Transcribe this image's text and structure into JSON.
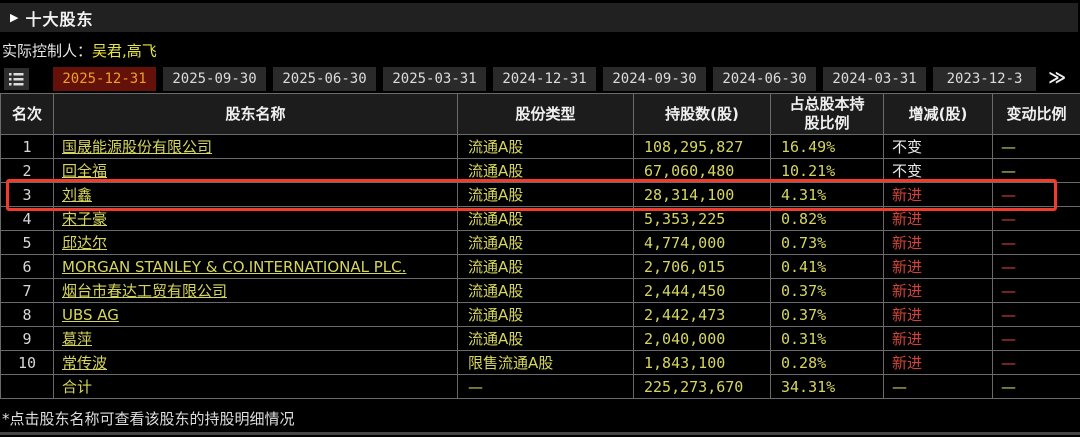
{
  "section": {
    "arrow": "▶",
    "title": "十大股东"
  },
  "controller": {
    "label": "实际控制人：",
    "value": "吴君,高飞"
  },
  "tabs": {
    "more_label": "≫",
    "dates": [
      {
        "label": "2025-12-31",
        "active": true
      },
      {
        "label": "2025-09-30",
        "active": false
      },
      {
        "label": "2025-06-30",
        "active": false
      },
      {
        "label": "2025-03-31",
        "active": false
      },
      {
        "label": "2024-12-31",
        "active": false
      },
      {
        "label": "2024-09-30",
        "active": false
      },
      {
        "label": "2024-06-30",
        "active": false
      },
      {
        "label": "2024-03-31",
        "active": false
      },
      {
        "label": "2023-12-3",
        "active": false
      }
    ]
  },
  "table": {
    "headers": [
      "名次",
      "股东名称",
      "股份类型",
      "持股数(股)",
      "占总股本持\n股比例",
      "增减(股)",
      "变动比例"
    ],
    "rows": [
      {
        "rank": "1",
        "name": "国晟能源股份有限公司",
        "share_type": "流通A股",
        "shares": "108,295,827",
        "pct": "16.49%",
        "change": "不变",
        "change_color": "white",
        "ratio": "—",
        "ratio_color": "yellow",
        "highlighted": false,
        "is_total": false
      },
      {
        "rank": "2",
        "name": "回全福",
        "share_type": "流通A股",
        "shares": "67,060,480",
        "pct": "10.21%",
        "change": "不变",
        "change_color": "white",
        "ratio": "—",
        "ratio_color": "yellow",
        "highlighted": false,
        "is_total": false
      },
      {
        "rank": "3",
        "name": "刘鑫",
        "share_type": "流通A股",
        "shares": "28,314,100",
        "pct": "4.31%",
        "change": "新进",
        "change_color": "red",
        "ratio": "—",
        "ratio_color": "red",
        "highlighted": true,
        "is_total": false
      },
      {
        "rank": "4",
        "name": "宋子豪",
        "share_type": "流通A股",
        "shares": "5,353,225",
        "pct": "0.82%",
        "change": "新进",
        "change_color": "red",
        "ratio": "—",
        "ratio_color": "red",
        "highlighted": false,
        "is_total": false
      },
      {
        "rank": "5",
        "name": "邱达尔",
        "share_type": "流通A股",
        "shares": "4,774,000",
        "pct": "0.73%",
        "change": "新进",
        "change_color": "red",
        "ratio": "—",
        "ratio_color": "red",
        "highlighted": false,
        "is_total": false
      },
      {
        "rank": "6",
        "name": "MORGAN STANLEY & CO.INTERNATIONAL PLC.",
        "share_type": "流通A股",
        "shares": "2,706,015",
        "pct": "0.41%",
        "change": "新进",
        "change_color": "red",
        "ratio": "—",
        "ratio_color": "red",
        "highlighted": false,
        "is_total": false
      },
      {
        "rank": "7",
        "name": "烟台市春达工贸有限公司",
        "share_type": "流通A股",
        "shares": "2,444,450",
        "pct": "0.37%",
        "change": "新进",
        "change_color": "red",
        "ratio": "—",
        "ratio_color": "red",
        "highlighted": false,
        "is_total": false
      },
      {
        "rank": "8",
        "name": "UBS AG",
        "share_type": "流通A股",
        "shares": "2,442,473",
        "pct": "0.37%",
        "change": "新进",
        "change_color": "red",
        "ratio": "—",
        "ratio_color": "red",
        "highlighted": false,
        "is_total": false
      },
      {
        "rank": "9",
        "name": "葛萍",
        "share_type": "流通A股",
        "shares": "2,040,000",
        "pct": "0.31%",
        "change": "新进",
        "change_color": "red",
        "ratio": "—",
        "ratio_color": "red",
        "highlighted": false,
        "is_total": false
      },
      {
        "rank": "10",
        "name": "常传波",
        "share_type": "限售流通A股",
        "shares": "1,843,100",
        "pct": "0.28%",
        "change": "新进",
        "change_color": "red",
        "ratio": "—",
        "ratio_color": "red",
        "highlighted": false,
        "is_total": false
      },
      {
        "rank": "",
        "name": "合计",
        "share_type": "—",
        "shares": "225,273,670",
        "pct": "34.31%",
        "change": "—",
        "change_color": "yellow",
        "ratio": "—",
        "ratio_color": "yellow",
        "highlighted": false,
        "is_total": true
      }
    ]
  },
  "footer": {
    "note": "*点击股东名称可查看该股东的持股明细情况"
  },
  "colors": {
    "active_tab_bg": "#641109",
    "active_tab_text": "#f09f25",
    "table_yellow": "#d6d65e",
    "new_entry_red": "#d0453a",
    "highlight_frame": "#f03b2d",
    "controller_yellow": "#e6e63e"
  }
}
